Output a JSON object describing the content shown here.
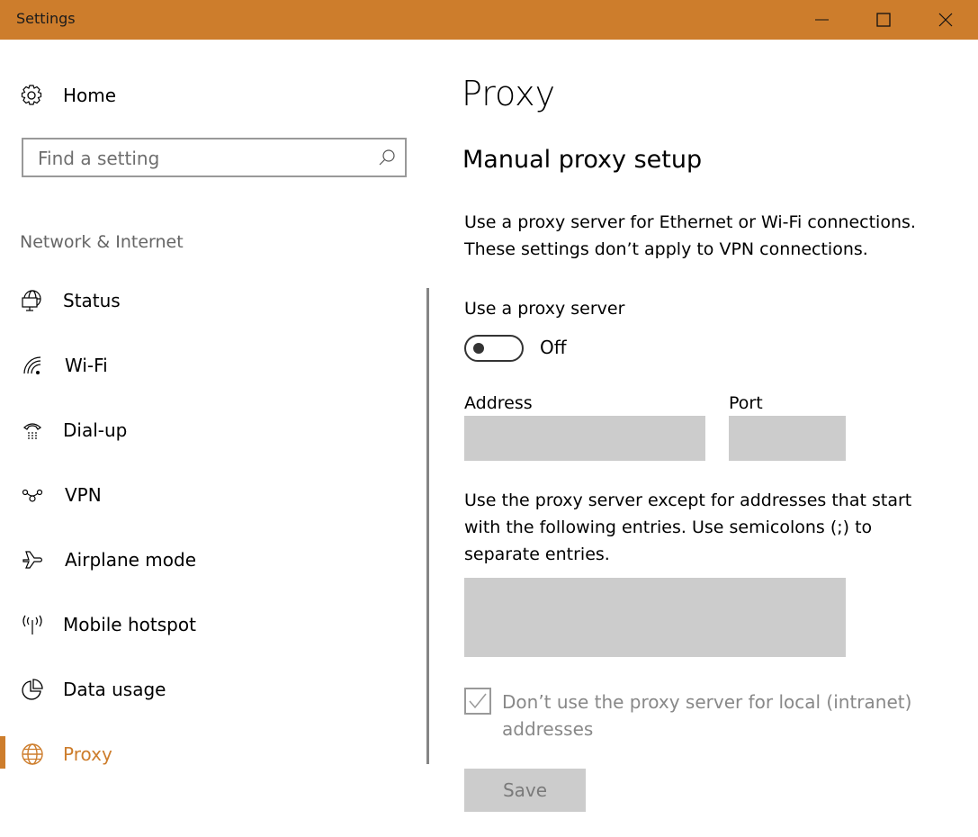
{
  "window": {
    "title": "Settings",
    "accent_color": "#cd7d2c",
    "controls": {
      "minimize": "minimize-icon",
      "maximize": "maximize-icon",
      "close": "close-icon"
    }
  },
  "sidebar": {
    "home_label": "Home",
    "search_placeholder": "Find a setting",
    "search_value": "",
    "section_title": "Network & Internet",
    "items": [
      {
        "label": "Status",
        "icon": "globe-monitor-icon",
        "active": false
      },
      {
        "label": "Wi-Fi",
        "icon": "wifi-icon",
        "active": false
      },
      {
        "label": "Dial-up",
        "icon": "dialup-phone-icon",
        "active": false
      },
      {
        "label": "VPN",
        "icon": "vpn-icon",
        "active": false
      },
      {
        "label": "Airplane mode",
        "icon": "airplane-icon",
        "active": false
      },
      {
        "label": "Mobile hotspot",
        "icon": "hotspot-icon",
        "active": false
      },
      {
        "label": "Data usage",
        "icon": "pie-chart-icon",
        "active": false
      },
      {
        "label": "Proxy",
        "icon": "globe-icon",
        "active": true
      }
    ]
  },
  "main": {
    "page_title": "Proxy",
    "section_title": "Manual proxy setup",
    "description_line1": "Use a proxy server for Ethernet or Wi-Fi connections.",
    "description_line2": "These settings don’t apply to VPN connections.",
    "use_proxy_label": "Use a proxy server",
    "toggle_state": "Off",
    "address_label": "Address",
    "address_value": "",
    "port_label": "Port",
    "port_value": "",
    "exceptions_line1": "Use the proxy server except for addresses that start",
    "exceptions_line2": "with the following entries. Use semicolons (;) to",
    "exceptions_line3": "separate entries.",
    "exceptions_value": "",
    "local_checkbox_label": "Don’t use the proxy server for local (intranet) addresses",
    "local_checkbox_checked": true,
    "save_label": "Save"
  }
}
